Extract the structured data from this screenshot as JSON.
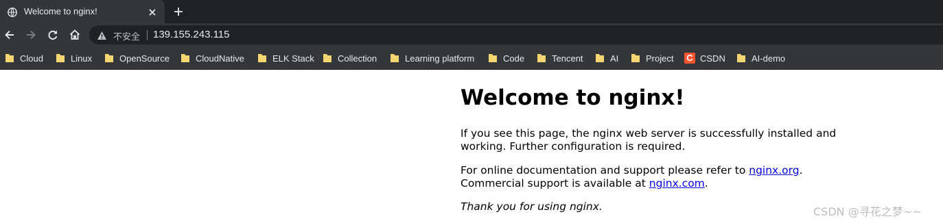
{
  "tab": {
    "title": "Welcome to nginx!",
    "icon": "globe-icon"
  },
  "toolbar": {
    "security_label": "不安全",
    "url": "139.155.243.115"
  },
  "bookmarks": [
    {
      "label": "Cloud",
      "icon": "folder-icon"
    },
    {
      "label": "Linux",
      "icon": "folder-icon"
    },
    {
      "label": "OpenSource",
      "icon": "folder-icon"
    },
    {
      "label": "CloudNative",
      "icon": "folder-icon"
    },
    {
      "label": "ELK Stack",
      "icon": "folder-icon"
    },
    {
      "label": "Collection",
      "icon": "folder-icon"
    },
    {
      "label": "Learning platform",
      "icon": "folder-icon"
    },
    {
      "label": "Code",
      "icon": "folder-icon"
    },
    {
      "label": "Tencent",
      "icon": "folder-icon"
    },
    {
      "label": "AI",
      "icon": "folder-icon"
    },
    {
      "label": "Project",
      "icon": "folder-icon"
    },
    {
      "label": "CSDN",
      "icon": "csdn-icon",
      "icon_text": "C"
    },
    {
      "label": "AI-demo",
      "icon": "folder-icon"
    }
  ],
  "page": {
    "heading": "Welcome to nginx!",
    "p1_line1": "If you see this page, the nginx web server is successfully installed and",
    "p1_line2": "working. Further configuration is required.",
    "p2_line1_before": "For online documentation and support please refer to ",
    "p2_link1": "nginx.org",
    "p2_line1_after": ".",
    "p2_line2_before": "Commercial support is available at ",
    "p2_link2": "nginx.com",
    "p2_line2_after": ".",
    "p3": "Thank you for using nginx."
  },
  "watermark": "CSDN @寻花之梦~~",
  "colors": {
    "chrome_dark": "#202124",
    "chrome_toolbar": "#35363a",
    "folder_yellow": "#f6d673",
    "link_blue": "#0000ee",
    "csdn_red": "#fc5531"
  }
}
